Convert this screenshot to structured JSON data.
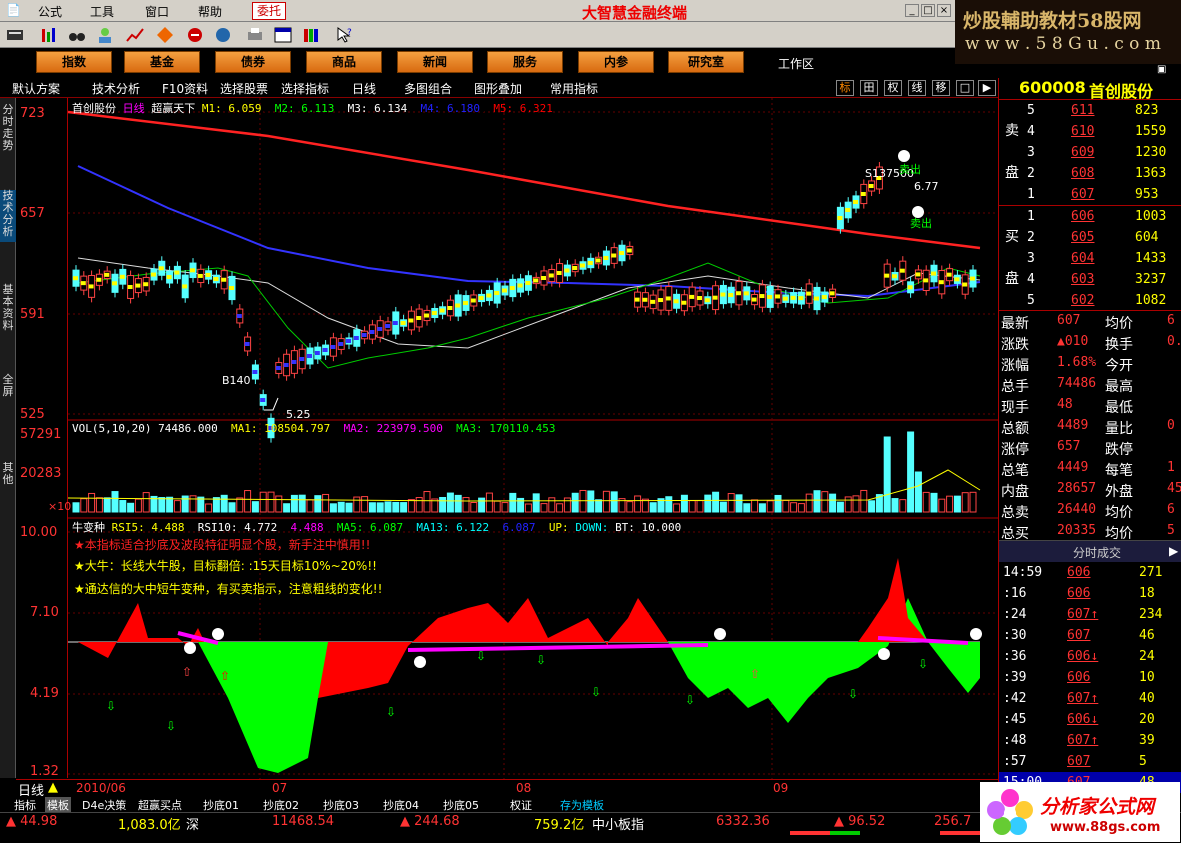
{
  "menu": {
    "items": [
      "公式",
      "工具",
      "窗口",
      "帮助"
    ],
    "active_tab": "委托",
    "app_title": "大智慧金融终端"
  },
  "logo": {
    "line1": "炒股輔助教材58股网",
    "line2": "w w w . 5 8 G u . c o m"
  },
  "nav": {
    "buttons": [
      "指数",
      "基金",
      "债券",
      "商品",
      "新闻",
      "服务",
      "内参",
      "研究室"
    ],
    "workspace": "工作区"
  },
  "subbar": {
    "items": [
      "默认方案",
      "技术分析",
      "F10资料",
      "选择股票",
      "选择指标",
      "日线",
      "多图组合",
      "图形叠加",
      "常用指标"
    ],
    "right_buttons": [
      "标",
      "田",
      "权",
      "线",
      "移"
    ]
  },
  "left_tabs": [
    "分时走势",
    "技术分析",
    "基本资料",
    "全屏",
    "其他"
  ],
  "kline": {
    "ylabels": [
      "723",
      "657",
      "591",
      "525"
    ],
    "legend": {
      "name": "首创股份",
      "period": "日线",
      "formula": "超赢天下",
      "m1": "M1: 6.059",
      "m2": "M2: 6.113",
      "m3": "M3: 6.134",
      "m4": "M4: 6.180",
      "m5": "M5: 6.321"
    },
    "annotations": {
      "s_label": "S137500",
      "high_label": "6.77",
      "b_label": "B140",
      "low_label": "5.25",
      "sell1": "卖出",
      "sell2": "卖出"
    }
  },
  "vol": {
    "ylabels": [
      "57291",
      "20283"
    ],
    "scale": "×10",
    "legend": {
      "head": "VOL(5,10,20)",
      "v": "74486.000",
      "ma1": "MA1: 108504.797",
      "ma2": "MA2: 223979.500",
      "ma3": "MA3: 170110.453"
    }
  },
  "osc": {
    "ylabels": [
      "10.00",
      "7.10",
      "4.19",
      "1.32"
    ],
    "legend": {
      "name": "牛变种",
      "rsi5": "RSI5: 4.488",
      "rsi10": "RSI10: 4.772",
      "v3": "4.488",
      "ma5": "MA5: 6.087",
      "ma13": "MA13: 6.122",
      "v6": "6.087",
      "up": "UP:",
      "down": "DOWN:",
      "bt": "BT: 10.000"
    },
    "notes": [
      "★本指标适合抄底及波段特征明显个股，新手注中慎用!!",
      "★大牛：长线大牛股，目标翻倍: :15天目标10%~20%!!",
      "★通达信的大中短牛变种，有买卖指示，注意粗线的变化!!"
    ]
  },
  "xaxis": {
    "period_label": "日线",
    "labels": [
      "2010/06",
      "07",
      "08",
      "09"
    ]
  },
  "quote": {
    "code": "600008",
    "name": "首创股份",
    "sell_label": [
      "卖",
      "盘"
    ],
    "buy_label": [
      "买",
      "盘"
    ],
    "asks": [
      {
        "n": "5",
        "p": "611",
        "v": "823"
      },
      {
        "n": "4",
        "p": "610",
        "v": "1559"
      },
      {
        "n": "3",
        "p": "609",
        "v": "1230"
      },
      {
        "n": "2",
        "p": "608",
        "v": "1363"
      },
      {
        "n": "1",
        "p": "607",
        "v": "953"
      }
    ],
    "bids": [
      {
        "n": "1",
        "p": "606",
        "v": "1003"
      },
      {
        "n": "2",
        "p": "605",
        "v": "604"
      },
      {
        "n": "3",
        "p": "604",
        "v": "1433"
      },
      {
        "n": "4",
        "p": "603",
        "v": "3237"
      },
      {
        "n": "5",
        "p": "602",
        "v": "1082"
      }
    ],
    "stats": [
      [
        "最新",
        "607",
        "均价",
        "6"
      ],
      [
        "涨跌",
        "▲010",
        "换手",
        "0.3"
      ],
      [
        "涨幅",
        "1.68%",
        "今开",
        ""
      ],
      [
        "总手",
        "74486",
        "最高",
        ""
      ],
      [
        "现手",
        "48",
        "最低",
        ""
      ],
      [
        "总额",
        "4489",
        "量比",
        "0"
      ],
      [
        "涨停",
        "657",
        "跌停",
        ""
      ],
      [
        "总笔",
        "4449",
        "每笔",
        "1"
      ],
      [
        "内盘",
        "28657",
        "外盘",
        "458"
      ],
      [
        "总卖",
        "26440",
        "均价",
        "6"
      ],
      [
        "总买",
        "20335",
        "均价",
        "5"
      ]
    ],
    "ticks_title": "分时成交",
    "ticks": [
      [
        "14:59",
        "606",
        "271"
      ],
      [
        ":16",
        "606",
        "18"
      ],
      [
        ":24",
        "607↑",
        "234"
      ],
      [
        ":30",
        "607",
        "46"
      ],
      [
        ":36",
        "606↓",
        "24"
      ],
      [
        ":39",
        "606",
        "10"
      ],
      [
        ":42",
        "607↑",
        "40"
      ],
      [
        ":45",
        "606↓",
        "20"
      ],
      [
        ":48",
        "607↑",
        "39"
      ],
      [
        ":57",
        "607",
        "5"
      ],
      [
        "15:00",
        "607",
        "48"
      ]
    ]
  },
  "bottom_tabs": [
    "指标",
    "模板",
    "D4e决策",
    "超赢买点",
    "抄底01",
    "抄底02",
    "抄底03",
    "抄底04",
    "抄底05",
    "权证",
    "存为模板"
  ],
  "status": {
    "sh_change": "▲ 44.98",
    "sh_amount": "1,083.0亿",
    "shen": "深",
    "sz_index": "11468.54",
    "sz_change": "▲ 244.68",
    "sz_amount": "759.2亿",
    "zxb": "中小板指",
    "zxb_index": "6332.36",
    "zxb_change": "▲ 96.52",
    "last": "256.7"
  },
  "watermark": {
    "title": "分析家公式网",
    "url": "www.88gs.com"
  }
}
